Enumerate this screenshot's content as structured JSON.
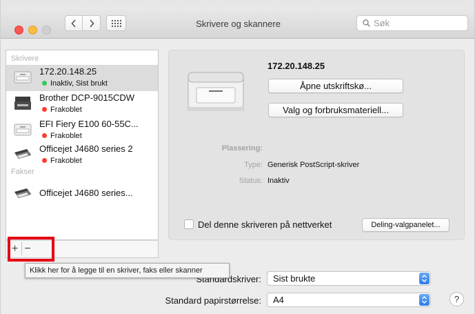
{
  "window": {
    "title": "Skrivere og skannere"
  },
  "search": {
    "placeholder": "Søk"
  },
  "sidebar": {
    "printers_header": "Skrivere",
    "fax_header": "Fakser",
    "printers": [
      {
        "name": "172.20.148.25",
        "status": "Inaktiv, Sist brukt",
        "status_color": "#34c759",
        "selected": true
      },
      {
        "name": "Brother DCP-9015CDW",
        "status": "Frakoblet",
        "status_color": "#ff3b30"
      },
      {
        "name": "EFI Fiery E100 60-55C...",
        "status": "Frakoblet",
        "status_color": "#ff3b30"
      },
      {
        "name": "Officejet J4680 series 2",
        "status": "Frakoblet",
        "status_color": "#ff3b30"
      }
    ],
    "faxes": [
      {
        "name": "Officejet J4680 series..."
      }
    ],
    "add_symbol": "+",
    "remove_symbol": "−"
  },
  "tooltip": {
    "text": "Klikk her for å legge til en skriver, faks eller skanner"
  },
  "detail": {
    "printer_name": "172.20.148.25",
    "open_queue_label": "Åpne utskriftskø...",
    "options_label": "Valg og forbruksmateriell...",
    "location_label": "Plassering:",
    "location_value": "",
    "type_label": "Type:",
    "type_value": "Generisk PostScript-skriver",
    "status_label": "Status:",
    "status_value": "Inaktiv",
    "share_label": "Del denne skriveren på nettverket",
    "share_prefs_label": "Deling-valgpanelet..."
  },
  "defaults": {
    "printer_label": "Standardskriver:",
    "printer_value": "Sist brukte",
    "paper_label": "Standard papirstørrelse:",
    "paper_value": "A4"
  },
  "help": {
    "label": "?"
  },
  "colors": {
    "highlight_box": "#e60012",
    "accent": "#2f7be8"
  }
}
